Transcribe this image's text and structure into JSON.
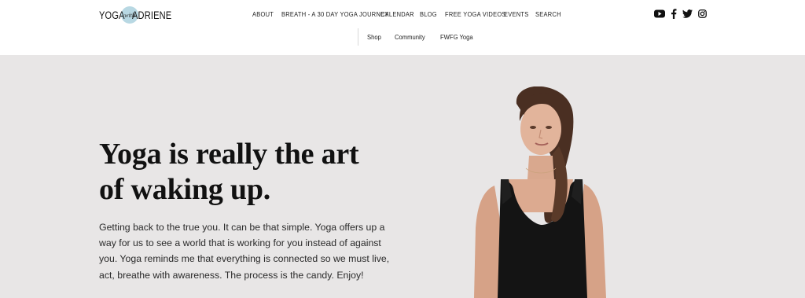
{
  "logo": {
    "word1": "YOGA",
    "with": "with",
    "word2": "ADRIENE"
  },
  "nav": {
    "items": [
      {
        "label": "ABOUT"
      },
      {
        "label": "BREATH - A 30 DAY YOGA JOURNEY"
      },
      {
        "label": "CALENDAR"
      },
      {
        "label": "BLOG"
      },
      {
        "label": "FREE YOGA VIDEOS"
      },
      {
        "label": "EVENTS"
      },
      {
        "label": "SEARCH"
      }
    ],
    "sub_items": [
      {
        "label": "Shop"
      },
      {
        "label": "Community"
      },
      {
        "label": "FWFG Yoga"
      }
    ]
  },
  "social": {
    "icons": [
      "youtube-icon",
      "facebook-icon",
      "twitter-icon",
      "instagram-icon"
    ]
  },
  "hero": {
    "headline_line1": "Yoga is really the art",
    "headline_line2": "of waking up.",
    "body_lines": [
      "Getting back to the true you. It can be that simple. Yoga offers up a",
      "way for us to see a world that is working for you instead of against",
      "you. Yoga reminds me that everything is connected so we must live,",
      "act, breathe with awareness. The process is the candy. Enjoy!"
    ],
    "background_color": "#e8e6e6"
  },
  "colors": {
    "logo_circle": "#b8d8e3",
    "text": "#111111"
  }
}
